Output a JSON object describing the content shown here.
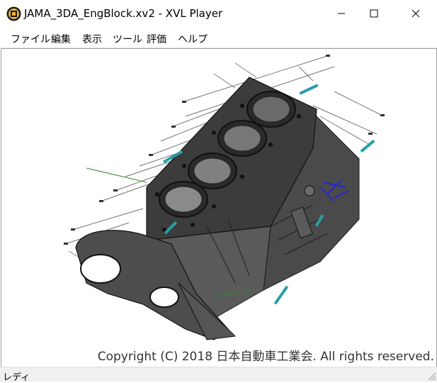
{
  "window": {
    "title": "JAMA_3DA_EngBlock.xv2 - XVL Player",
    "icon": "xvl-player-icon"
  },
  "title_buttons": {
    "minimize": "minimize-icon",
    "maximize": "maximize-icon",
    "close": "close-icon"
  },
  "menu": {
    "items": [
      {
        "label": "ファイル"
      },
      {
        "label": "編集"
      },
      {
        "label": "表示"
      },
      {
        "label": "ツール"
      },
      {
        "label": "評価"
      },
      {
        "label": "ヘルプ"
      }
    ]
  },
  "viewport": {
    "model": "engine-block-3d-model",
    "copyright": "Copyright (C) 2018 日本自動車工業会. All rights reserved."
  },
  "status": {
    "text": "レディ"
  },
  "colors": {
    "model_fill": "#3c3c3c",
    "annotation_cyan": "#2a9da8",
    "annotation_blue": "#1a1aff",
    "annotation_green": "#2e8b2e"
  }
}
